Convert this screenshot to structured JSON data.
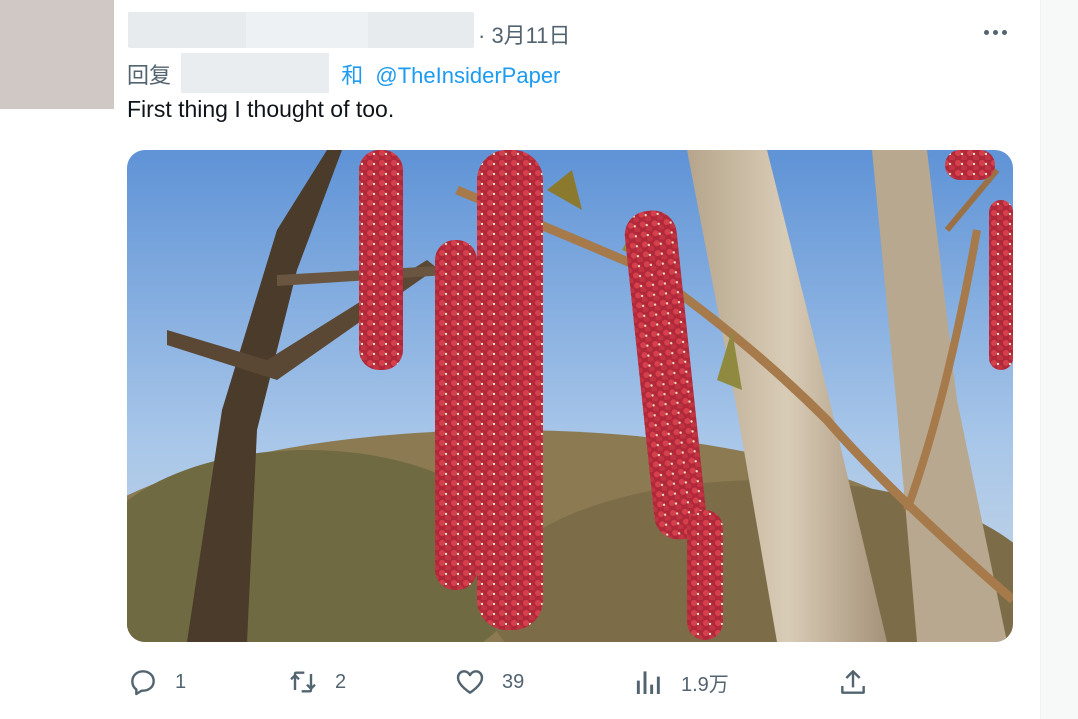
{
  "tweet": {
    "date": "· 3月11日",
    "reply_prefix": "回复",
    "reply_and": "和",
    "reply_handle": "@TheInsiderPaper",
    "text": "First thing I thought of too."
  },
  "actions": {
    "reply_count": "1",
    "retweet_count": "2",
    "like_count": "39",
    "views_count": "1.9万"
  },
  "icons": [
    "more-icon",
    "reply-icon",
    "retweet-icon",
    "like-icon",
    "views-icon",
    "share-icon"
  ],
  "colors": {
    "link": "#1d9bf0",
    "muted": "#536471",
    "text": "#0f1419"
  }
}
